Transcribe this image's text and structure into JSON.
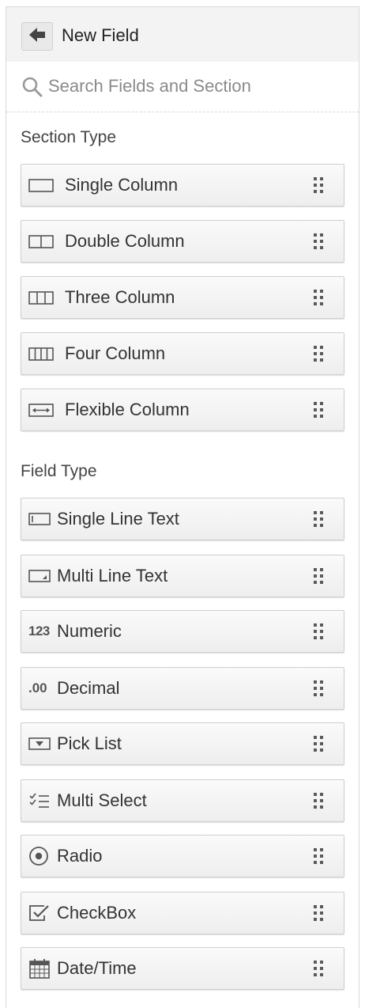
{
  "header": {
    "title": "New Field",
    "back_icon": "arrow-left-icon"
  },
  "search": {
    "placeholder": "Search Fields and Section",
    "value": "",
    "icon": "search-icon"
  },
  "section_type": {
    "label": "Section Type",
    "items": [
      {
        "label": "Single Column",
        "icon": "single-column-icon"
      },
      {
        "label": "Double Column",
        "icon": "double-column-icon"
      },
      {
        "label": "Three Column",
        "icon": "three-column-icon"
      },
      {
        "label": "Four Column",
        "icon": "four-column-icon"
      },
      {
        "label": "Flexible Column",
        "icon": "flexible-column-icon"
      }
    ]
  },
  "field_type": {
    "label": "Field Type",
    "items": [
      {
        "label": "Single Line Text",
        "icon": "single-line-text-icon"
      },
      {
        "label": "Multi Line Text",
        "icon": "multi-line-text-icon"
      },
      {
        "label": "Numeric",
        "icon": "numeric-icon",
        "icon_text": "123"
      },
      {
        "label": "Decimal",
        "icon": "decimal-icon",
        "icon_text": ".00"
      },
      {
        "label": "Pick List",
        "icon": "pick-list-icon"
      },
      {
        "label": "Multi Select",
        "icon": "multi-select-icon"
      },
      {
        "label": "Radio",
        "icon": "radio-icon"
      },
      {
        "label": "CheckBox",
        "icon": "checkbox-icon"
      },
      {
        "label": "Date/Time",
        "icon": "calendar-icon"
      }
    ]
  }
}
